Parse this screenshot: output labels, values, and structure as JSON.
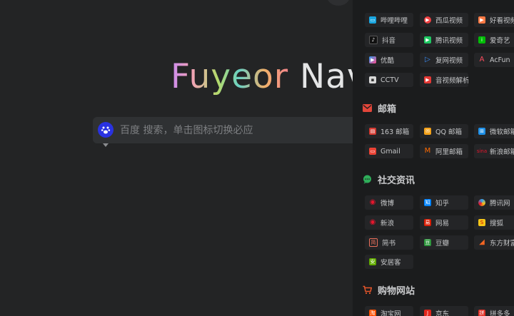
{
  "logo": {
    "brand": "Fuyeor",
    "suffix": "Nav"
  },
  "search": {
    "placeholder": "百度 搜索，单击图标切换必应",
    "engine_icon": "baidu-paw-icon"
  },
  "sidebar": {
    "video": {
      "items": [
        {
          "label": "哔哩哔哩",
          "icon": "bilibili-icon",
          "color": "#1aa6e0"
        },
        {
          "label": "西瓜视频",
          "icon": "xigua-icon",
          "color": "#f04142"
        },
        {
          "label": "好看视频",
          "icon": "haokan-icon",
          "color": "#ff7a45"
        },
        {
          "label": "抖音",
          "icon": "douyin-icon",
          "color": "#111111"
        },
        {
          "label": "腾讯视频",
          "icon": "tencent-video-icon",
          "color": "#1ec862"
        },
        {
          "label": "爱奇艺",
          "icon": "iqiyi-icon",
          "color": "#00be06"
        },
        {
          "label": "优酷",
          "icon": "youku-icon",
          "color": "#2c9cf0"
        },
        {
          "label": "复网视频",
          "icon": "play-icon",
          "color": "#3b8df5"
        },
        {
          "label": "AcFun",
          "icon": "acfun-icon",
          "color": "#fd4c5d"
        },
        {
          "label": "CCTV",
          "icon": "cctv-icon",
          "color": "#d8d8d8"
        },
        {
          "label": "音视频解析",
          "icon": "youtube-icon",
          "color": "#e53935"
        }
      ]
    },
    "mail": {
      "title": "邮箱",
      "icon": "envelope-icon",
      "color": "#e2463a",
      "items": [
        {
          "label": "163 邮箱",
          "icon": "mail-163-icon",
          "color": "#d33a31"
        },
        {
          "label": "QQ 邮箱",
          "icon": "qq-mail-icon",
          "color": "#f4a21a"
        },
        {
          "label": "微软邮箱",
          "icon": "outlook-icon",
          "color": "#1e90e8"
        },
        {
          "label": "Gmail",
          "icon": "gmail-icon",
          "color": "#ea4335"
        },
        {
          "label": "阿里邮箱",
          "icon": "aliyun-mail-icon",
          "color": "#ff6a00"
        },
        {
          "label": "新浪邮箱",
          "icon": "sina-mail-icon",
          "color": "#e6162d"
        }
      ]
    },
    "social": {
      "title": "社交资讯",
      "icon": "chat-bubble-icon",
      "color": "#2fae5a",
      "items": [
        {
          "label": "微博",
          "icon": "weibo-icon",
          "color": "#e6162d"
        },
        {
          "label": "知乎",
          "icon": "zhihu-icon",
          "color": "#0084ff"
        },
        {
          "label": "腾讯网",
          "icon": "qq-news-icon",
          "color": "#2fa3f5"
        },
        {
          "label": "新浪",
          "icon": "sina-icon",
          "color": "#e6162d"
        },
        {
          "label": "网易",
          "icon": "netease-icon",
          "color": "#d81e06"
        },
        {
          "label": "搜狐",
          "icon": "sohu-icon",
          "color": "#f5c518"
        },
        {
          "label": "简书",
          "icon": "jianshu-icon",
          "color": "#ea6f5a"
        },
        {
          "label": "豆瓣",
          "icon": "douban-icon",
          "color": "#2e963d"
        },
        {
          "label": "东方财富",
          "icon": "eastmoney-icon",
          "color": "#f26522"
        },
        {
          "label": "安居客",
          "icon": "anjuke-icon",
          "color": "#62ab00"
        }
      ]
    },
    "shopping": {
      "title": "购物网站",
      "icon": "cart-icon",
      "color": "#e8562a",
      "items": [
        {
          "label": "淘宝网",
          "icon": "taobao-icon",
          "color": "#ff5000"
        },
        {
          "label": "京东",
          "icon": "jd-icon",
          "color": "#e1251b"
        },
        {
          "label": "拼多多",
          "icon": "pinduoduo-icon",
          "color": "#e02e24"
        }
      ]
    }
  }
}
